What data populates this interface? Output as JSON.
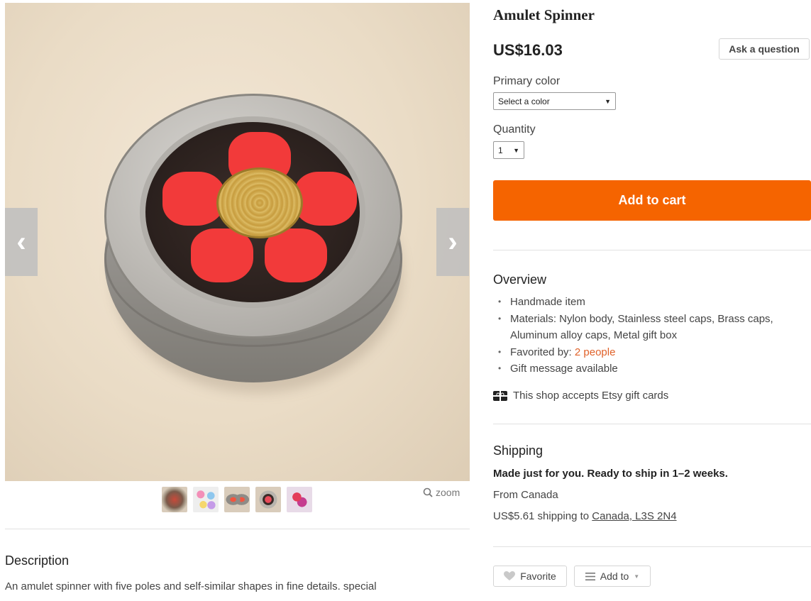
{
  "listing": {
    "title": "Amulet Spinner",
    "price": "US$16.03",
    "ask_label": "Ask a question"
  },
  "options": {
    "color_label": "Primary color",
    "color_value": "Select a color",
    "quantity_label": "Quantity",
    "quantity_value": "1"
  },
  "cart": {
    "label": "Add to cart",
    "color": "#f56400"
  },
  "overview": {
    "heading": "Overview",
    "item1": "Handmade item",
    "item2": "Materials: Nylon body, Stainless steel caps, Brass caps, Aluminum alloy caps, Metal gift box",
    "item3_prefix": "Favorited by:",
    "item3_link": "2 people",
    "item4": "Gift message available",
    "giftcards": "This shop accepts Etsy gift cards"
  },
  "shipping": {
    "heading": "Shipping",
    "ready": "Made just for you. Ready to ship in 1–2 weeks.",
    "from": "From Canada",
    "cost_prefix": "US$5.61 shipping to",
    "destination": "Canada, L3S 2N4"
  },
  "actions": {
    "favorite_label": "Favorite",
    "addto_label": "Add to"
  },
  "gallery": {
    "zoom_label": "zoom",
    "thumbnail_count": 5,
    "prev_icon": "chevron-left-icon",
    "next_icon": "chevron-right-icon"
  },
  "description": {
    "heading": "Description",
    "text": "An amulet spinner with five poles and self-similar shapes in fine details. special"
  }
}
